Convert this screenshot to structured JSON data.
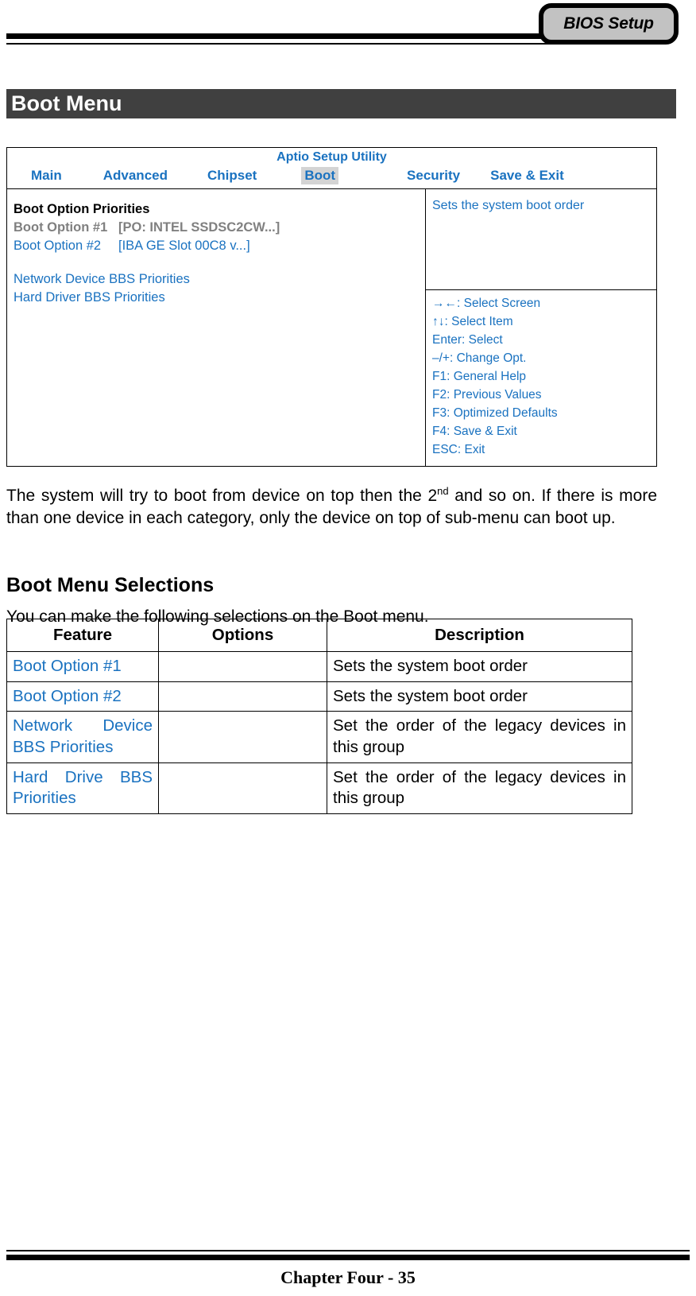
{
  "header": {
    "badge_label": "BIOS Setup"
  },
  "section": {
    "title": "Boot Menu"
  },
  "bios_screen": {
    "utility_title": "Aptio Setup Utility",
    "tabs": [
      {
        "label": "Main",
        "active": false
      },
      {
        "label": "Advanced",
        "active": false
      },
      {
        "label": "Chipset",
        "active": false
      },
      {
        "label": "Boot",
        "active": true
      },
      {
        "label": "Security",
        "active": false
      },
      {
        "label": "Save & Exit",
        "active": false
      }
    ],
    "left_panel": {
      "heading": "Boot Option Priorities",
      "options": [
        {
          "name": "Boot Option #1",
          "value": "[PO: INTEL SSDSC2CW...]",
          "state": "highlighted"
        },
        {
          "name": "Boot Option #2",
          "value": "[IBA GE Slot 00C8 v...]",
          "state": "normal"
        }
      ],
      "submenus": [
        "Network Device BBS Priorities",
        "Hard Driver BBS Priorities"
      ]
    },
    "help_text": "Sets the system boot order",
    "key_legend": [
      "→←: Select Screen",
      "↑↓: Select Item",
      "Enter: Select",
      "–/+: Change Opt.",
      "F1: General Help",
      "F2: Previous Values",
      "F3: Optimized Defaults",
      "F4: Save & Exit",
      "ESC: Exit"
    ]
  },
  "intro_paragraph": {
    "part1": "The system will try to boot from device on top then the 2",
    "ordinal": "nd",
    "part2": " and so on. If there is more than one device in each category, only the device on top of sub-menu can boot up."
  },
  "selections": {
    "heading": "Boot Menu Selections",
    "intro": "You can make the following selections on the Boot menu.",
    "columns": [
      "Feature",
      "Options",
      "Description"
    ],
    "rows": [
      {
        "feature": "Boot Option #1",
        "options": "",
        "description": "Sets the system boot order"
      },
      {
        "feature": "Boot Option #2",
        "options": "",
        "description": "Sets the system boot order"
      },
      {
        "feature": "Network Device BBS Priorities",
        "options": "",
        "description": "Set the order of the legacy devices in this group"
      },
      {
        "feature": "Hard Drive BBS Priorities",
        "options": "",
        "description": "Set the order of the legacy devices in this group"
      }
    ]
  },
  "footer": {
    "label": "Chapter Four - 35"
  },
  "colors": {
    "bios_blue": "#1a72c0",
    "section_bar": "#404040",
    "badge_fill": "#c2c2c2",
    "tab_highlight": "#d4d4d4",
    "dim_gray": "#808080"
  }
}
